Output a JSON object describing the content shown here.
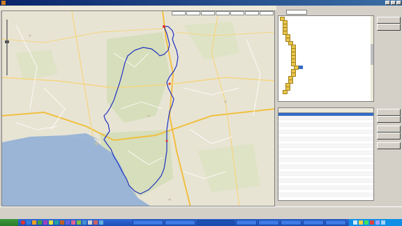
{
  "window": {
    "title": ""
  },
  "menu": [
    {
      "label": ""
    },
    {
      "label": ""
    },
    {
      "label": ""
    },
    {
      "label": ""
    },
    {
      "label": ""
    },
    {
      "label": ""
    },
    {
      "label": ""
    },
    {
      "label": ""
    }
  ],
  "map": {
    "labels": [
      {
        "text": ""
      },
      {
        "text": ""
      },
      {
        "text": ""
      },
      {
        "text": ""
      },
      {
        "text": ""
      },
      {
        "text": ""
      },
      {
        "text": ""
      },
      {
        "text": ""
      },
      {
        "text": ""
      },
      {
        "text": ""
      },
      {
        "text": ""
      },
      {
        "text": ""
      },
      {
        "text": ""
      },
      {
        "text": ""
      },
      {
        "text": ""
      },
      {
        "text": ""
      },
      {
        "text": ""
      },
      {
        "text": ""
      },
      {
        "text": ""
      }
    ],
    "toolbar_buttons": [
      "",
      "",
      "",
      "",
      "",
      "",
      ""
    ],
    "colors": {
      "land": "#e8e4d4",
      "water": "#9ab5d6",
      "forest": "#cfdcb0",
      "route": "#2030c0",
      "road_major": "#f0c040",
      "road": "#ffffff"
    }
  },
  "tree": {
    "search_label": "",
    "items": [
      {
        "label": ""
      },
      {
        "label": ""
      },
      {
        "label": ""
      },
      {
        "label": ""
      },
      {
        "label": ""
      },
      {
        "label": ""
      },
      {
        "label": ""
      },
      {
        "label": ""
      },
      {
        "label": ""
      },
      {
        "label": ""
      },
      {
        "label": ""
      },
      {
        "label": ""
      },
      {
        "label": ""
      },
      {
        "label": ""
      },
      {
        "label": ""
      },
      {
        "label": ""
      },
      {
        "label": ""
      },
      {
        "label": ""
      },
      {
        "label": ""
      },
      {
        "label": ""
      },
      {
        "label": ""
      },
      {
        "label": ""
      }
    ]
  },
  "side_buttons": {
    "top": [
      "",
      ""
    ],
    "bottom": [
      "",
      "",
      "",
      "",
      ""
    ]
  },
  "table": {
    "title": "",
    "columns": [
      "",
      "",
      ""
    ],
    "rows": [
      {
        "a": "",
        "b": "",
        "c": ""
      },
      {
        "a": "",
        "b": "",
        "c": ""
      },
      {
        "a": "",
        "b": "",
        "c": ""
      },
      {
        "a": "",
        "b": "",
        "c": ""
      },
      {
        "a": "",
        "b": "",
        "c": ""
      },
      {
        "a": "",
        "b": "",
        "c": ""
      },
      {
        "a": "",
        "b": "",
        "c": ""
      },
      {
        "a": "",
        "b": "",
        "c": ""
      },
      {
        "a": "",
        "b": "",
        "c": ""
      },
      {
        "a": "",
        "b": "",
        "c": ""
      },
      {
        "a": "",
        "b": "",
        "c": ""
      },
      {
        "a": "",
        "b": "",
        "c": ""
      },
      {
        "a": "",
        "b": "",
        "c": ""
      },
      {
        "a": "",
        "b": "",
        "c": ""
      },
      {
        "a": "",
        "b": "",
        "c": ""
      },
      {
        "a": "",
        "b": "",
        "c": ""
      },
      {
        "a": "",
        "b": "",
        "c": ""
      },
      {
        "a": "",
        "b": "",
        "c": ""
      },
      {
        "a": "",
        "b": "",
        "c": ""
      },
      {
        "a": "",
        "b": "",
        "c": ""
      },
      {
        "a": "",
        "b": "",
        "c": ""
      },
      {
        "a": "",
        "b": "",
        "c": ""
      },
      {
        "a": "",
        "b": "",
        "c": ""
      },
      {
        "a": "",
        "b": "",
        "c": ""
      }
    ]
  },
  "taskbar": {
    "start_label": "",
    "tasks": [
      "",
      "",
      "",
      "",
      "",
      "",
      "",
      ""
    ],
    "clock": ""
  }
}
